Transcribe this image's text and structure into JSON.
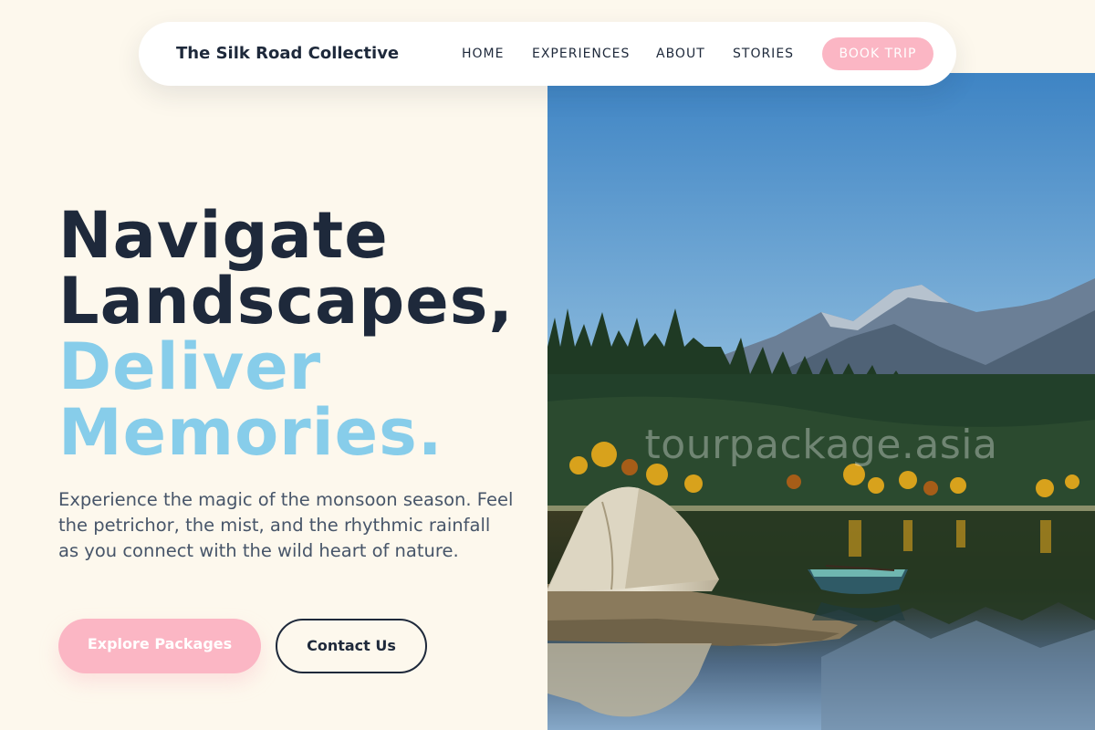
{
  "nav": {
    "brand": "The Silk Road Collective",
    "links": [
      "HOME",
      "EXPERIENCES",
      "ABOUT",
      "STORIES"
    ],
    "cta": "BOOK TRIP"
  },
  "hero": {
    "headline_line1": "Navigate",
    "headline_line2": "Landscapes,",
    "headline_line3": "Deliver",
    "headline_line4": "Memories.",
    "description": "Experience the magic of the monsoon season. Feel the petrichor, the mist, and the rhythmic rainfall as you connect with the wild heart of nature.",
    "primary_button": "Explore Packages",
    "secondary_button": "Contact Us"
  },
  "image": {
    "watermark": "tourpackage.asia"
  },
  "colors": {
    "background": "#fdf8ed",
    "dark_text": "#1e293b",
    "accent_blue": "#87cdea",
    "accent_pink": "#fbb6c4"
  }
}
